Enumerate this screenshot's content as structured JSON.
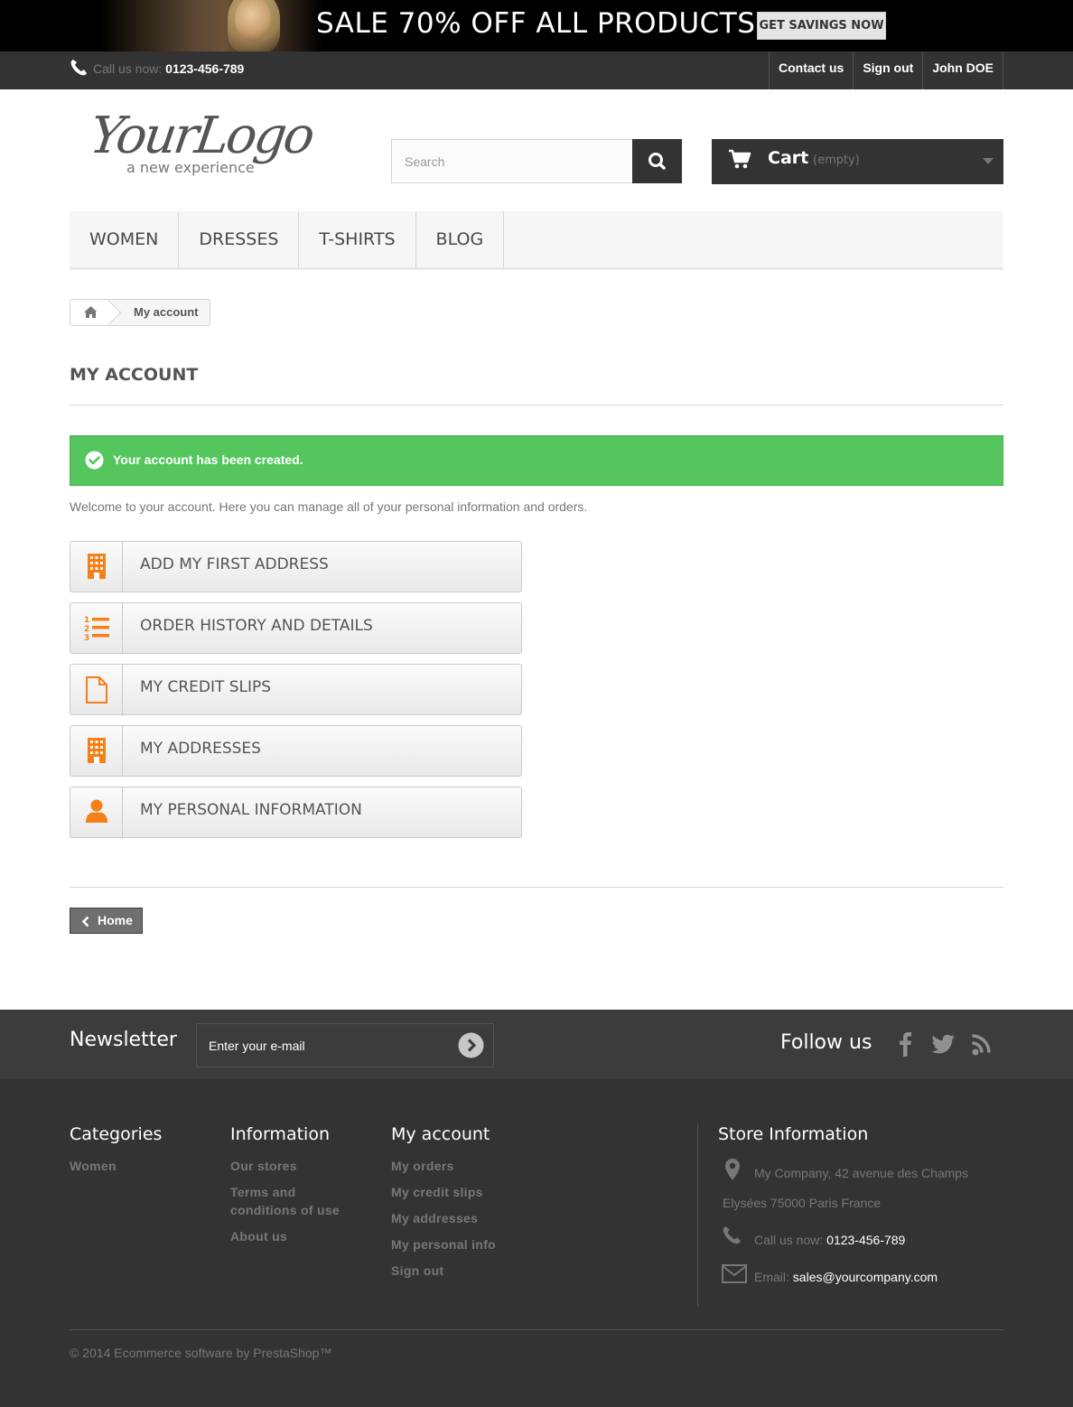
{
  "banner": {
    "headline": "SALE 70% OFF ALL PRODUCTS",
    "cta": "GET SAVINGS NOW"
  },
  "topnav": {
    "call_label": "Call us now:",
    "phone": "0123-456-789",
    "links": [
      "Contact us",
      "Sign out",
      "John DOE"
    ]
  },
  "header": {
    "logo_text": "YourLogo",
    "logo_tagline": "a new experience",
    "search_placeholder": "Search",
    "cart_label": "Cart",
    "cart_status": "(empty)"
  },
  "menu": [
    "WOMEN",
    "DRESSES",
    "T-SHIRTS",
    "BLOG"
  ],
  "breadcrumb": {
    "current": "My account"
  },
  "page": {
    "title": "MY ACCOUNT",
    "alert": "Your account has been created.",
    "intro": "Welcome to your account. Here you can manage all of your personal information and orders.",
    "links": [
      {
        "label": "ADD MY FIRST ADDRESS",
        "icon": "building-icon"
      },
      {
        "label": "ORDER HISTORY AND DETAILS",
        "icon": "numbered-list-icon"
      },
      {
        "label": "MY CREDIT SLIPS",
        "icon": "file-icon"
      },
      {
        "label": "MY ADDRESSES",
        "icon": "building-icon"
      },
      {
        "label": "MY PERSONAL INFORMATION",
        "icon": "user-icon"
      }
    ],
    "home_button": "Home"
  },
  "newsletter": {
    "title": "Newsletter",
    "placeholder": "Enter your e-mail",
    "follow_label": "Follow us"
  },
  "footer": {
    "categories": {
      "title": "Categories",
      "links": [
        "Women"
      ]
    },
    "information": {
      "title": "Information",
      "links": [
        "Our stores",
        "Terms and conditions of use",
        "About us"
      ]
    },
    "my_account": {
      "title": "My account",
      "links": [
        "My orders",
        "My credit slips",
        "My addresses",
        "My personal info",
        "Sign out"
      ]
    },
    "store": {
      "title": "Store Information",
      "address_line1": "My Company, 42 avenue des Champs",
      "address_line2": "Elysées 75000 Paris France",
      "call_label": "Call us now:",
      "phone": "0123-456-789",
      "email_label": "Email:",
      "email": "sales@yourcompany.com"
    },
    "copyright": "© 2014 Ecommerce software by PrestaShop™"
  },
  "colors": {
    "accent_orange": "#f48017",
    "success_green": "#55c65e",
    "dark": "#333333"
  }
}
